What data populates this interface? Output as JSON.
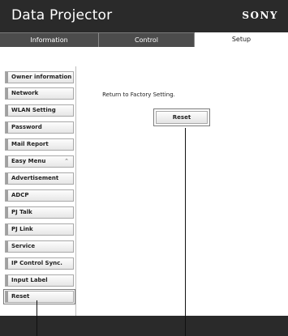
{
  "header": {
    "title": "Data Projector",
    "brand": "SONY"
  },
  "tabs": [
    {
      "label": "Information",
      "active": false
    },
    {
      "label": "Control",
      "active": false
    },
    {
      "label": "Setup",
      "active": true
    }
  ],
  "sidebar": {
    "items": [
      {
        "label": "Owner information"
      },
      {
        "label": "Network"
      },
      {
        "label": "WLAN Setting"
      },
      {
        "label": "Password"
      },
      {
        "label": "Mail Report"
      },
      {
        "label": "Easy Menu"
      },
      {
        "label": "Advertisement"
      },
      {
        "label": "ADCP"
      },
      {
        "label": "PJ Talk"
      },
      {
        "label": "PJ Link"
      },
      {
        "label": "Service"
      },
      {
        "label": "IP Control Sync."
      },
      {
        "label": "Input Label"
      },
      {
        "label": "Reset"
      }
    ]
  },
  "main": {
    "factory_text": "Return to Factory Setting.",
    "reset_label": "Reset"
  },
  "colors": {
    "header_bg": "#2a2a2a",
    "tab_inactive_bg": "#4c4c4c",
    "button_border": "#a8a8a8"
  },
  "icons": {
    "easy_menu_expand": "chevron-up-icon"
  }
}
